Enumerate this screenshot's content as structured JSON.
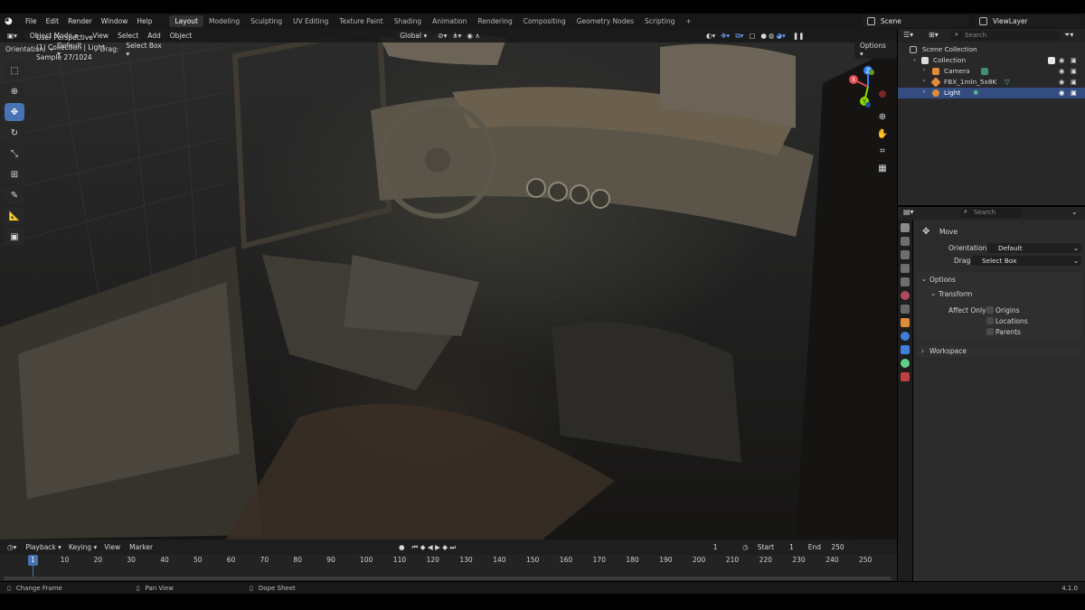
{
  "topbar": {
    "menu": [
      "File",
      "Edit",
      "Render",
      "Window",
      "Help"
    ],
    "workspaces": [
      "Layout",
      "Modeling",
      "Sculpting",
      "UV Editing",
      "Texture Paint",
      "Shading",
      "Animation",
      "Rendering",
      "Compositing",
      "Geometry Nodes",
      "Scripting"
    ],
    "active_workspace": "Layout",
    "add_workspace": "+",
    "scene": "Scene",
    "view_layer": "ViewLayer"
  },
  "viewport_header": {
    "mode": "Object Mode",
    "menus": [
      "View",
      "Select",
      "Add",
      "Object"
    ],
    "transform_orientation": "Global",
    "options_label": "Options"
  },
  "tool_header": {
    "orientation_label": "Orientation:",
    "orientation_value": "Default",
    "drag_label": "Drag:",
    "drag_value": "Select Box"
  },
  "viewport_overlay": {
    "perspective": "User Perspective",
    "collection_info": "(1) Collection | Light",
    "sample": "Sample 27/1024"
  },
  "gizmo": {
    "x": "X",
    "y": "Y",
    "z": "Z"
  },
  "timeline": {
    "menus": [
      "Playback",
      "Keying",
      "View",
      "Marker"
    ],
    "current_frame": "1",
    "start_label": "Start",
    "start_value": "1",
    "end_label": "End",
    "end_value": "250",
    "ruler": [
      "10",
      "20",
      "30",
      "40",
      "50",
      "60",
      "70",
      "80",
      "90",
      "100",
      "110",
      "120",
      "130",
      "140",
      "150",
      "160",
      "170",
      "180",
      "190",
      "200",
      "210",
      "220",
      "230",
      "240",
      "250"
    ],
    "playhead": "1"
  },
  "statusbar": {
    "hint1": "Change Frame",
    "hint2": "Pan View",
    "hint3": "Dope Sheet",
    "version": "4.1.0"
  },
  "outliner": {
    "search_placeholder": "Search",
    "rows": [
      "Scene Collection",
      "Collection",
      "Camera",
      "FBX_1mln_5x8K",
      "Light"
    ]
  },
  "properties": {
    "search_placeholder": "Search",
    "tool_name": "Move",
    "orientation_label": "Orientation",
    "orientation_value": "Default",
    "drag_label": "Drag:",
    "drag_value": "Select Box",
    "options_panel": "Options",
    "transform_panel": "Transform",
    "affect_only": "Affect Only",
    "origins": "Origins",
    "locations": "Locations",
    "parents": "Parents",
    "workspace_panel": "Workspace"
  },
  "colors": {
    "accent": "#4772b3",
    "selection": "#334d80",
    "axis_x": "#e5484d",
    "axis_y": "#8bdc00",
    "axis_z": "#2f83ff"
  }
}
